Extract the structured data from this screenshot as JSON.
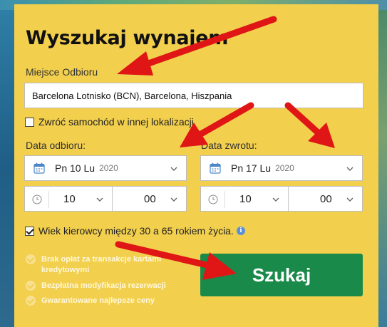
{
  "form": {
    "title": "Wyszukaj wynajem",
    "pickup_location_label": "Miejsce Odbioru",
    "pickup_location_value": "Barcelona Lotnisko (BCN), Barcelona, Hiszpania",
    "return_elsewhere_label": "Zwróć samochód w innej lokalizacji",
    "return_elsewhere_checked": false,
    "pickup_date_label": "Data odbioru:",
    "return_date_label": "Data zwrotu:",
    "pickup_date": {
      "day": "Pn 10 Lu",
      "year": "2020",
      "hour": "10",
      "minute": "00"
    },
    "return_date": {
      "day": "Pn 17 Lu",
      "year": "2020",
      "hour": "10",
      "minute": "00"
    },
    "driver_age_label": "Wiek kierowcy między 30 a 65 rokiem życia.",
    "driver_age_checked": true,
    "search_button_label": "Szukaj"
  },
  "benefits": [
    "Brak opłat za transakcje kartami kredytowymi",
    "Bezpłatna modyfikacja rezerwacji",
    "Gwarantowane najlepsze ceny"
  ],
  "colors": {
    "panel": "#f2cf4d",
    "button": "#1a8a4a",
    "arrow": "#e01515"
  }
}
